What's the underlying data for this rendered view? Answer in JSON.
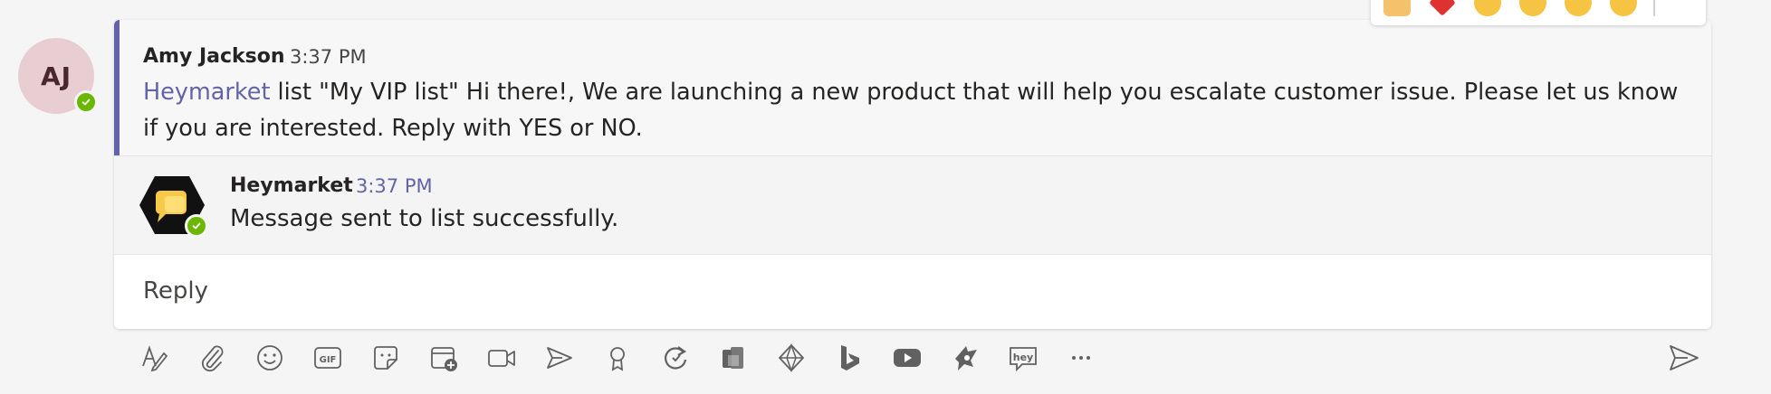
{
  "sender": {
    "initials": "AJ",
    "name": "Amy Jackson",
    "time": "3:37 PM",
    "mention": "Heymarket",
    "message": " list \"My VIP list\" Hi there!, We are launching a new product that will help you escalate customer issue. Please let us know if you are interested. Reply with YES or NO."
  },
  "bot_reply": {
    "name": "Heymarket",
    "time": "3:37 PM",
    "text": "Message sent to list successfully."
  },
  "reply_box": {
    "label": "Reply"
  },
  "toolbar_icons": [
    "format-icon",
    "attach-icon",
    "emoji-icon",
    "gif-icon",
    "sticker-icon",
    "schedule-meeting-icon",
    "meet-now-icon",
    "stream-icon",
    "praise-icon",
    "loop-icon",
    "office-apps-icon",
    "polly-icon",
    "bing-icon",
    "youtube-icon",
    "app-icon",
    "heymarket-icon",
    "more-options-icon",
    "send-icon"
  ],
  "colors": {
    "accent": "#6264a7",
    "presence": "#6bb700",
    "avatar_bg": "#e8cdd3"
  }
}
